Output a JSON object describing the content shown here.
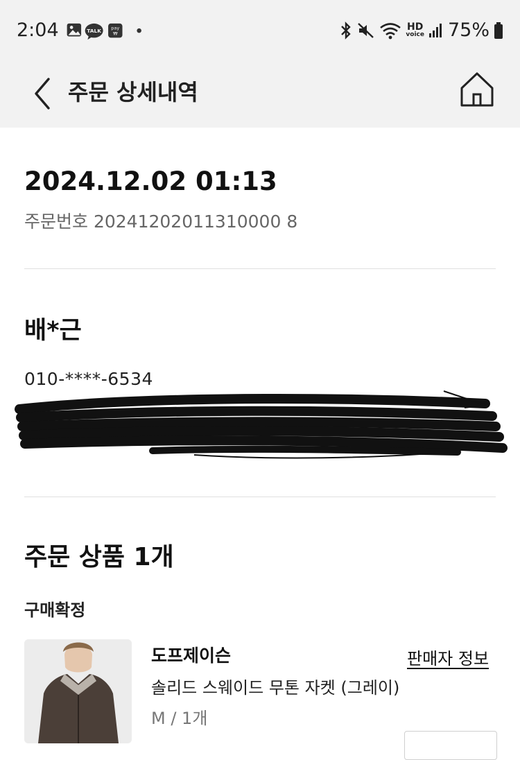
{
  "status_bar": {
    "time": "2:04",
    "talk_badge": "TALK",
    "hd_label": "HD",
    "voice_label": "voice",
    "battery": "75%"
  },
  "header": {
    "title": "주문 상세내역"
  },
  "order": {
    "datetime": "2024.12.02 01:13",
    "number_label": "주문번호",
    "number": "20241202011310000 8"
  },
  "recipient": {
    "name": "배*근",
    "phone": "010-****-6534"
  },
  "products": {
    "heading": "주문 상품 1개",
    "status": "구매확정",
    "items": [
      {
        "brand": "도프제이슨",
        "name": "솔리드 스웨이드 무톤 자켓 (그레이)",
        "option": "M / 1개",
        "seller_link": "판매자 정보"
      }
    ]
  },
  "colors": {
    "header_bg": "#f2f2f2",
    "text_primary": "#111111",
    "text_secondary": "#666666",
    "divider": "#e0e0e0"
  }
}
